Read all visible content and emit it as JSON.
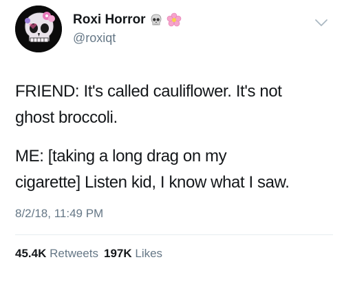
{
  "tweet": {
    "author": {
      "display_name": "Roxi Horror",
      "handle": "@roxiqt",
      "emojis": [
        "skull-icon",
        "flower-icon"
      ]
    },
    "body": {
      "paragraph_1": [
        "FRIEND: It's called cauliflower. It's not",
        "ghost broccoli."
      ],
      "paragraph_2": [
        "ME: [taking a long drag on my",
        "cigarette] Listen kid, I know what I saw."
      ]
    },
    "timestamp": "8/2/18, 11:49 PM",
    "stats": {
      "retweets_count": "45.4K",
      "retweets_label": "Retweets",
      "likes_count": "197K",
      "likes_label": "Likes"
    }
  },
  "colors": {
    "text_primary": "#14171a",
    "text_secondary": "#657786",
    "divider": "#e6ecf0"
  }
}
